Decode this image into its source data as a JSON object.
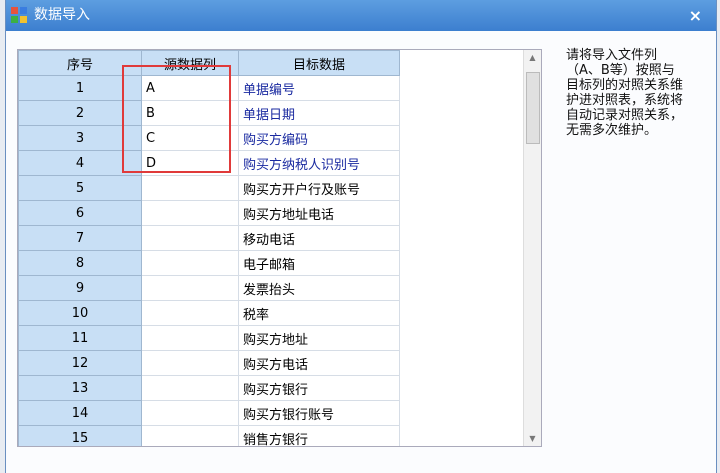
{
  "window": {
    "title": "数据导入",
    "close": "×"
  },
  "table": {
    "headers": [
      "序号",
      "源数据列",
      "目标数据"
    ],
    "rows": [
      {
        "seq": "1",
        "src": "A",
        "target": "单据编号",
        "mapped": true
      },
      {
        "seq": "2",
        "src": "B",
        "target": "单据日期",
        "mapped": true
      },
      {
        "seq": "3",
        "src": "C",
        "target": "购买方编码",
        "mapped": true
      },
      {
        "seq": "4",
        "src": "D",
        "target": "购买方纳税人识别号",
        "mapped": true
      },
      {
        "seq": "5",
        "src": "",
        "target": "购买方开户行及账号"
      },
      {
        "seq": "6",
        "src": "",
        "target": "购买方地址电话"
      },
      {
        "seq": "7",
        "src": "",
        "target": "移动电话"
      },
      {
        "seq": "8",
        "src": "",
        "target": "电子邮箱"
      },
      {
        "seq": "9",
        "src": "",
        "target": "发票抬头"
      },
      {
        "seq": "10",
        "src": "",
        "target": "税率"
      },
      {
        "seq": "11",
        "src": "",
        "target": "购买方地址"
      },
      {
        "seq": "12",
        "src": "",
        "target": "购买方电话"
      },
      {
        "seq": "13",
        "src": "",
        "target": "购买方银行"
      },
      {
        "seq": "14",
        "src": "",
        "target": "购买方银行账号"
      },
      {
        "seq": "15",
        "src": "",
        "target": "销售方银行"
      }
    ]
  },
  "help": "请将导入文件列（A、B等）按照与目标列的对照关系维护进对照表，系统将自动记录对照关系，无需多次维护。"
}
